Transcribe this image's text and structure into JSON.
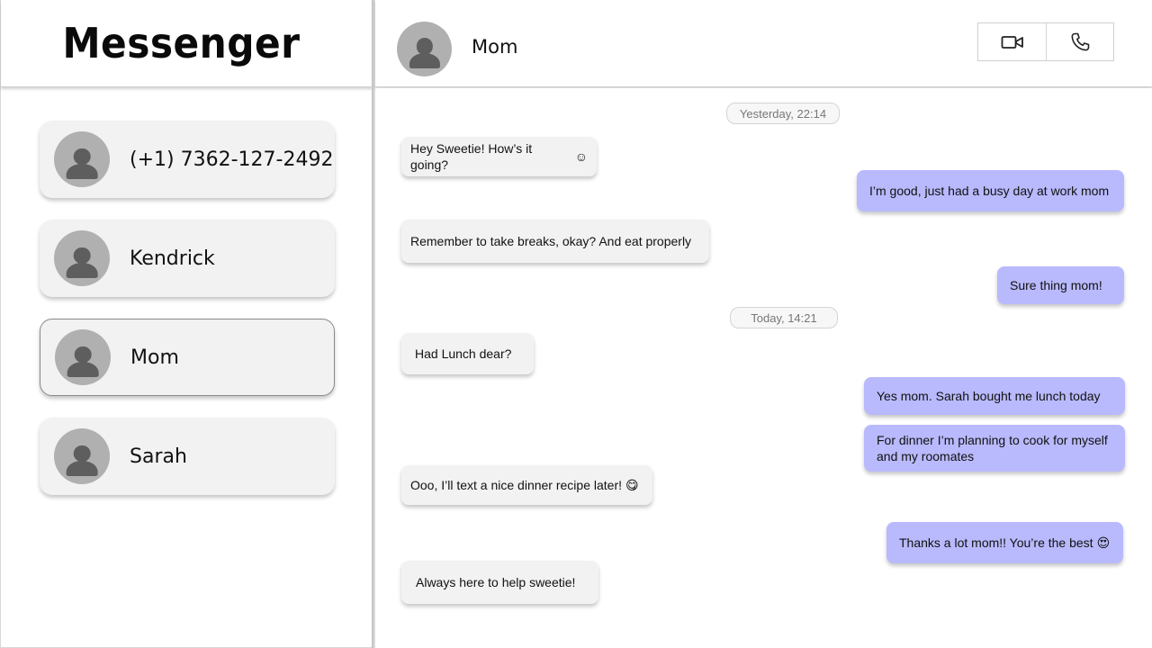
{
  "app": {
    "title": "Messenger"
  },
  "contacts": [
    {
      "name": "(+1) 7362-127-2492"
    },
    {
      "name": "Kendrick"
    },
    {
      "name": "Mom"
    },
    {
      "name": "Sarah"
    }
  ],
  "chat": {
    "contact_name": "Mom",
    "actions": {
      "video_icon": "video-camera-icon",
      "call_icon": "phone-icon"
    },
    "timestamps": [
      "Yesterday, 22:14",
      "Today, 14:21"
    ],
    "messages": [
      {
        "direction": "in",
        "text": "Hey Sweetie! How’s it going?",
        "emoji": "☺"
      },
      {
        "direction": "out",
        "text": "I’m good, just had a busy day at work mom"
      },
      {
        "direction": "in",
        "text": "Remember to take breaks, okay? And eat properly"
      },
      {
        "direction": "out",
        "text": "Sure thing mom!"
      },
      {
        "direction": "in",
        "text": "Had Lunch dear?"
      },
      {
        "direction": "out",
        "text": "Yes mom. Sarah bought me lunch today"
      },
      {
        "direction": "out",
        "text": "For dinner I’m planning to cook for myself and my roomates"
      },
      {
        "direction": "in",
        "text": "Ooo, I’ll text a nice dinner recipe later!",
        "emoji": "😋"
      },
      {
        "direction": "out",
        "text": "Thanks a lot mom!! You’re the best",
        "emoji": "😍"
      },
      {
        "direction": "in",
        "text": "Always here to help sweetie!"
      }
    ]
  },
  "colors": {
    "outgoing_bubble": "#b9b9fd",
    "incoming_bubble": "#f2f2f2",
    "avatar_bg": "#b0b0b0",
    "avatar_fg": "#5e5e5e"
  }
}
